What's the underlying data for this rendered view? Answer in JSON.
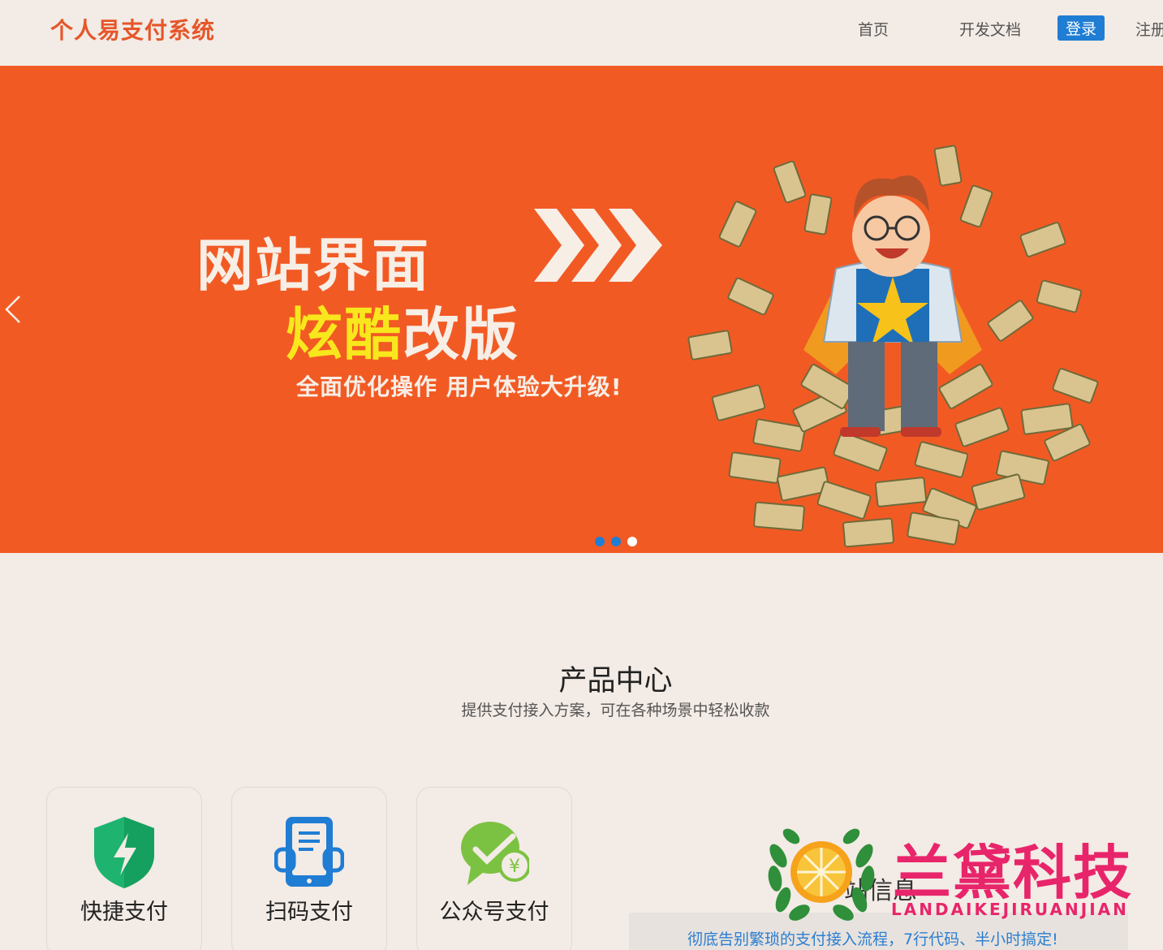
{
  "header": {
    "logo": "个人易支付系统",
    "nav": {
      "home": "首页",
      "docs": "开发文档",
      "login": "登录",
      "register": "注册"
    }
  },
  "banner": {
    "headline_1": "网站界面",
    "headline_2_highlight": "炫酷",
    "headline_2_rest": "改版",
    "subtitle": "全面优化操作 用户体验大升级!",
    "slides_total": 3,
    "active_slide": 3,
    "colors": {
      "background": "#f25a24",
      "highlight": "#f8e71c",
      "dot_active": "#ffffff",
      "dot_inactive": "#1f7dd4"
    }
  },
  "products": {
    "title": "产品中心",
    "subtitle": "提供支付接入方案，可在各种场景中轻松收款",
    "cards": [
      {
        "label": "快捷支付",
        "icon": "shield-lightning-icon"
      },
      {
        "label": "扫码支付",
        "icon": "scan-phone-icon"
      },
      {
        "label": "公众号支付",
        "icon": "wechat-yuan-icon"
      }
    ]
  },
  "info": {
    "heading": "站信息",
    "text": "彻底告别繁琐的支付接入流程，7行代码、半小时搞定!"
  },
  "watermark": {
    "title": "兰黛科技",
    "subtitle": "LANDAIKEJIRUANJIAN"
  }
}
